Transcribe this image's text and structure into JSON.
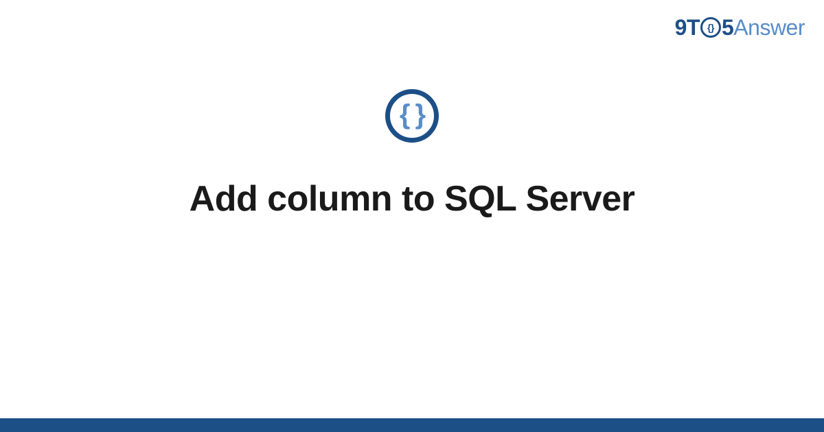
{
  "logo": {
    "part1": "9T",
    "circle_inner": "{}",
    "part2": "5",
    "part3": "Answer"
  },
  "icon": {
    "braces": "{ }"
  },
  "title": "Add column to SQL Server",
  "colors": {
    "dark_blue": "#1d4f87",
    "light_blue": "#5a8dc7"
  }
}
